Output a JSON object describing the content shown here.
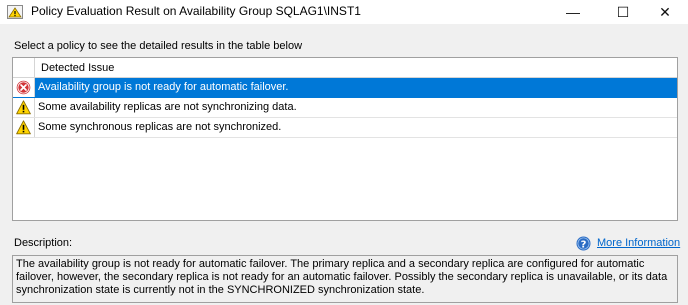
{
  "window": {
    "title": "Policy Evaluation Result on Availability Group SQLAG1\\INST1",
    "controls": {
      "minimize": "—",
      "maximize": "☐",
      "close": "✕"
    }
  },
  "instruction": "Select a policy to see the detailed results in the table below",
  "grid": {
    "column_header": "Detected Issue",
    "rows": [
      {
        "icon": "error-icon",
        "text": "Availability group is not ready for automatic failover.",
        "selected": true
      },
      {
        "icon": "warning-icon",
        "text": "Some availability replicas are not synchronizing data.",
        "selected": false
      },
      {
        "icon": "warning-icon",
        "text": "Some synchronous replicas are not synchronized.",
        "selected": false
      }
    ]
  },
  "description": {
    "label": "Description:",
    "more_info": "More Information",
    "text": "The availability group is not ready for automatic failover. The primary replica and a secondary replica are configured for automatic failover, however, the secondary replica is not ready for an automatic failover. Possibly the secondary replica is unavailable, or its data synchronization state is currently not in the SYNCHRONIZED synchronization state."
  },
  "colors": {
    "selection": "#0078d7",
    "link": "#0066cc",
    "error": "#d13438",
    "warning": "#ffd400",
    "help": "#2b6cc4"
  }
}
